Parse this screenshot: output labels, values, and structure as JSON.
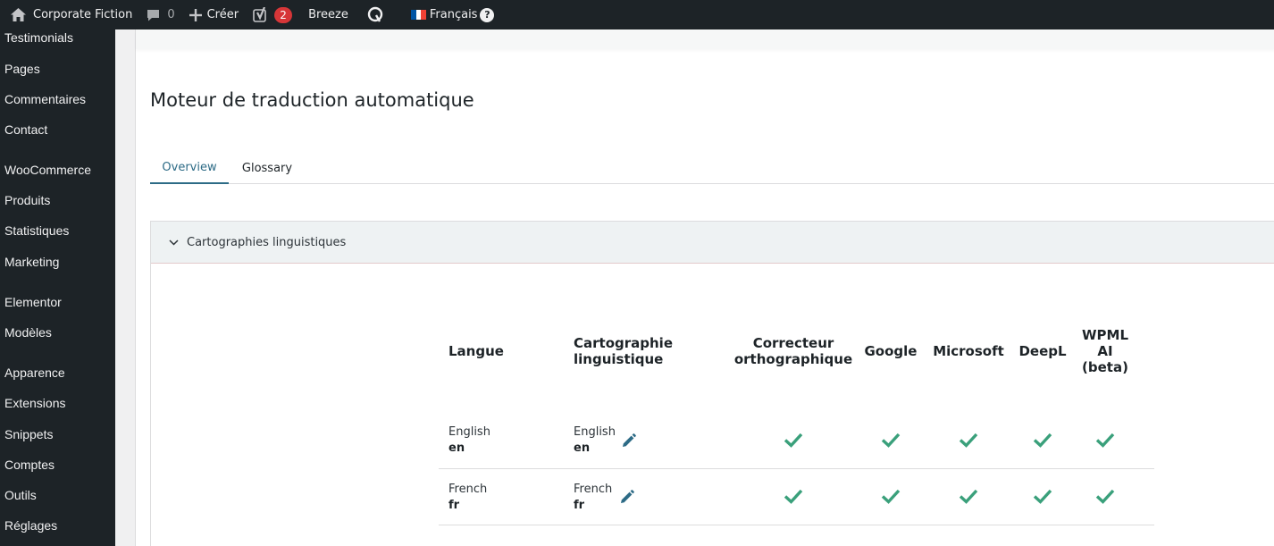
{
  "admin_bar": {
    "site_name": "Corporate Fiction",
    "comments_count": "0",
    "create_label": "Créer",
    "yoast_badge": "2",
    "breeze_label": "Breeze",
    "language_label": "Français",
    "help_label": "?"
  },
  "sidebar": {
    "items": [
      {
        "label": "Testimonials"
      },
      {
        "label": "Pages"
      },
      {
        "label": "Commentaires"
      },
      {
        "label": "Contact"
      },
      {
        "label": "WooCommerce"
      },
      {
        "label": "Produits"
      },
      {
        "label": "Statistiques"
      },
      {
        "label": "Marketing"
      },
      {
        "label": "Elementor"
      },
      {
        "label": "Modèles"
      },
      {
        "label": "Apparence"
      },
      {
        "label": "Extensions"
      },
      {
        "label": "Snippets"
      },
      {
        "label": "Comptes"
      },
      {
        "label": "Outils"
      },
      {
        "label": "Réglages"
      }
    ]
  },
  "page": {
    "title": "Moteur de traduction automatique",
    "tabs": [
      {
        "label": "Overview",
        "active": true
      },
      {
        "label": "Glossary",
        "active": false
      }
    ],
    "panel_title": "Cartographies linguistiques"
  },
  "table": {
    "headers": {
      "language": "Langue",
      "mapping_1": "Cartographie",
      "mapping_2": "linguistique",
      "spell_1": "Correcteur",
      "spell_2": "orthographique",
      "google": "Google",
      "microsoft": "Microsoft",
      "deepl": "DeepL",
      "wpml_1": "WPML",
      "wpml_2": "AI",
      "wpml_3": "(beta)"
    },
    "rows": [
      {
        "lang_name": "English",
        "lang_code": "en",
        "map_name": "English",
        "map_code": "en"
      },
      {
        "lang_name": "French",
        "lang_code": "fr",
        "map_name": "French",
        "map_code": "fr"
      }
    ]
  },
  "colors": {
    "check": "#3aa07b",
    "accent": "#2d6b86",
    "admin_bg": "#1d2327",
    "badge": "#d63638"
  }
}
